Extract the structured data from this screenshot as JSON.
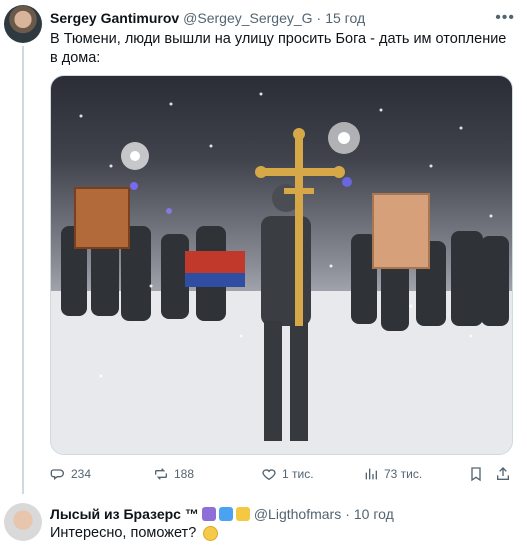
{
  "tweet": {
    "author_name": "Sergey Gantimurov",
    "handle": "@Sergey_Sergey_G",
    "separator": "·",
    "time": "15 год",
    "text": "В Тюмени, люди вышли на улицу просить Бога - дать им отопление в дома:",
    "more_icon": "more-icon",
    "media_icon": "photo",
    "actions": {
      "replies": "234",
      "retweets": "188",
      "likes": "1 тис.",
      "views": "73 тис."
    }
  },
  "reply": {
    "author_name": "Лысый из Бразерс ™",
    "handle": "@Ligthofmars",
    "separator": "·",
    "time": "10 год",
    "text": "Интересно, поможет?",
    "badges": [
      "star-of-david",
      "blue-square",
      "yellow-square"
    ],
    "emoji": "slightly-frowning-face"
  },
  "colors": {
    "text_primary": "#0f1419",
    "text_secondary": "#536471",
    "border": "#cfd9de",
    "badge_purple": "#8e6fd8",
    "badge_blue": "#4aa3f0",
    "badge_yellow": "#f5c842"
  }
}
